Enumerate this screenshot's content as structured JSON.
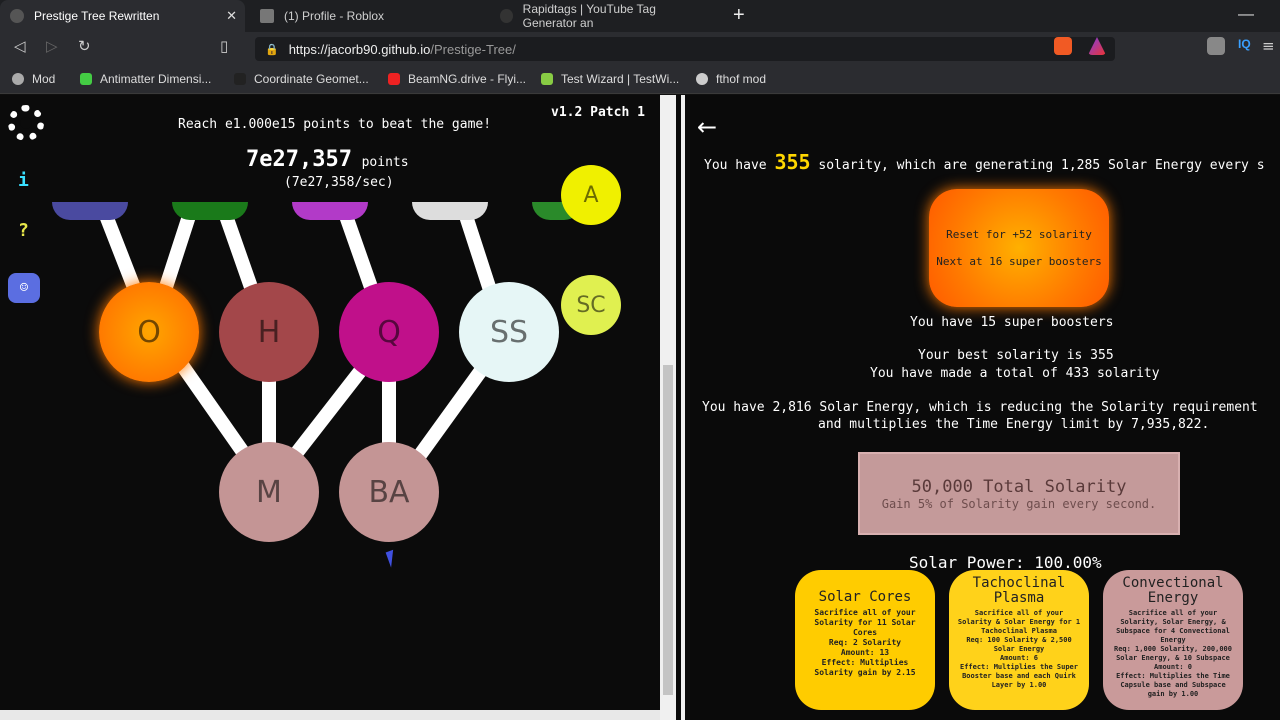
{
  "browser": {
    "tabs": [
      {
        "label": "Prestige Tree Rewritten",
        "active": true
      },
      {
        "label": "(1) Profile - Roblox",
        "active": false
      },
      {
        "label": "Rapidtags | YouTube Tag Generator an",
        "active": false
      }
    ],
    "url_host": "https://jacorb90.github.io",
    "url_path": "/Prestige-Tree/",
    "bookmarks": [
      "Mod",
      "Antimatter Dimensi...",
      "Coordinate Geomet...",
      "BeamNG.drive - Flyi...",
      "Test Wizard | TestWi...",
      "fthof mod"
    ]
  },
  "game": {
    "goal": "Reach e1.000e15 points to beat the game!",
    "version": "v1.2 Patch 1",
    "points_value": "7e27,357",
    "points_unit": "points",
    "points_rate": "(7e27,358/sec)",
    "side_icons": {
      "info": "i",
      "help": "?"
    },
    "nodes": {
      "o": "O",
      "h": "H",
      "q": "Q",
      "ss": "SS",
      "m": "M",
      "ba": "BA",
      "a": "A",
      "sc": "SC"
    }
  },
  "info": {
    "solarity_prefix": "You have",
    "solarity_amount": "355",
    "solarity_suffix": "solarity, which are generating 1,285 Solar Energy every s",
    "reset_line1": "Reset for +52 solarity",
    "reset_line2": "Next at 16 super boosters",
    "super_boosters": "You have 15 super boosters",
    "best_solarity": "Your best solarity is 355",
    "total_solarity": "You have made a total of 433 solarity",
    "solar_energy_line1": "You have 2,816 Solar Energy, which is reducing the Solarity requirement",
    "solar_energy_line2": "and multiplies the Time Energy limit by 7,935,822.",
    "milestone_title": "50,000 Total Solarity",
    "milestone_desc": "Gain 5% of Solarity gain every second.",
    "solar_power": "Solar Power: 100.00%",
    "upgrades": [
      {
        "title": "Solar Cores",
        "desc": "Sacrifice all of your Solarity for 11 Solar Cores\nReq: 2 Solarity\nAmount: 13\nEffect: Multiplies Solarity gain by 2.15",
        "color": "#ffcc00"
      },
      {
        "title": "Tachoclinal Plasma",
        "desc": "Sacrifice all of your Solarity & Solar Energy for 1 Tachoclinal Plasma\nReq: 100 Solarity & 2,500 Solar Energy\nAmount: 6\nEffect: Multiplies the Super Booster base and each Quirk Layer by 1.00",
        "color": "#ffd21a"
      },
      {
        "title": "Convectional Energy",
        "desc": "Sacrifice all of your Solarity, Solar Energy, & Subspace for 4 Convectional Energy\nReq: 1,000 Solarity, 200,000 Solar Energy, & 10 Subspace\nAmount: 0\nEffect: Multiplies the Time Capsule base and Subspace gain by 1.00",
        "color": "#c99a9a"
      }
    ]
  }
}
